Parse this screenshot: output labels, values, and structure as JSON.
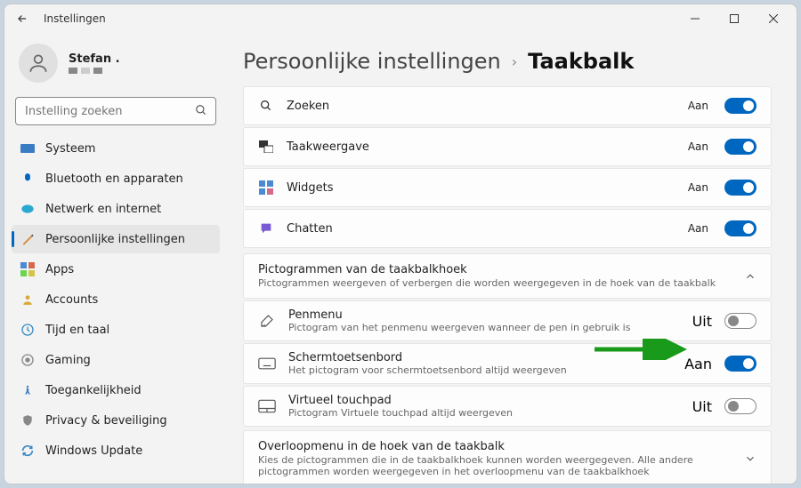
{
  "window": {
    "title": "Instellingen"
  },
  "user": {
    "name": "Stefan ."
  },
  "search": {
    "placeholder": "Instelling zoeken"
  },
  "sidebar": {
    "items": [
      {
        "label": "Systeem"
      },
      {
        "label": "Bluetooth en apparaten"
      },
      {
        "label": "Netwerk en internet"
      },
      {
        "label": "Persoonlijke instellingen"
      },
      {
        "label": "Apps"
      },
      {
        "label": "Accounts"
      },
      {
        "label": "Tijd en taal"
      },
      {
        "label": "Gaming"
      },
      {
        "label": "Toegankelijkheid"
      },
      {
        "label": "Privacy & beveiliging"
      },
      {
        "label": "Windows Update"
      }
    ],
    "active_index": 3
  },
  "breadcrumb": {
    "parent": "Persoonlijke instellingen",
    "current": "Taakbalk"
  },
  "taskbar_items": [
    {
      "label": "Zoeken",
      "state": "Aan",
      "on": true,
      "icon": "search"
    },
    {
      "label": "Taakweergave",
      "state": "Aan",
      "on": true,
      "icon": "taskview"
    },
    {
      "label": "Widgets",
      "state": "Aan",
      "on": true,
      "icon": "widgets"
    },
    {
      "label": "Chatten",
      "state": "Aan",
      "on": true,
      "icon": "chat"
    }
  ],
  "corner_section": {
    "title": "Pictogrammen van de taakbalkhoek",
    "subtitle": "Pictogrammen weergeven of verbergen die worden weergegeven in de hoek van de taakbalk"
  },
  "corner_items": [
    {
      "title": "Penmenu",
      "subtitle": "Pictogram van het penmenu weergeven wanneer de pen in gebruik is",
      "state": "Uit",
      "on": false,
      "icon": "pen"
    },
    {
      "title": "Schermtoetsenbord",
      "subtitle": "Het pictogram voor schermtoetsenbord altijd weergeven",
      "state": "Aan",
      "on": true,
      "icon": "keyboard"
    },
    {
      "title": "Virtueel touchpad",
      "subtitle": "Pictogram Virtuele touchpad altijd weergeven",
      "state": "Uit",
      "on": false,
      "icon": "touchpad"
    }
  ],
  "overflow_section": {
    "title": "Overloopmenu in de hoek van de taakbalk",
    "subtitle": "Kies de pictogrammen die in de taakbalkhoek kunnen worden weergegeven. Alle andere pictogrammen worden weergegeven in het overloopmenu van de taakbalkhoek"
  }
}
